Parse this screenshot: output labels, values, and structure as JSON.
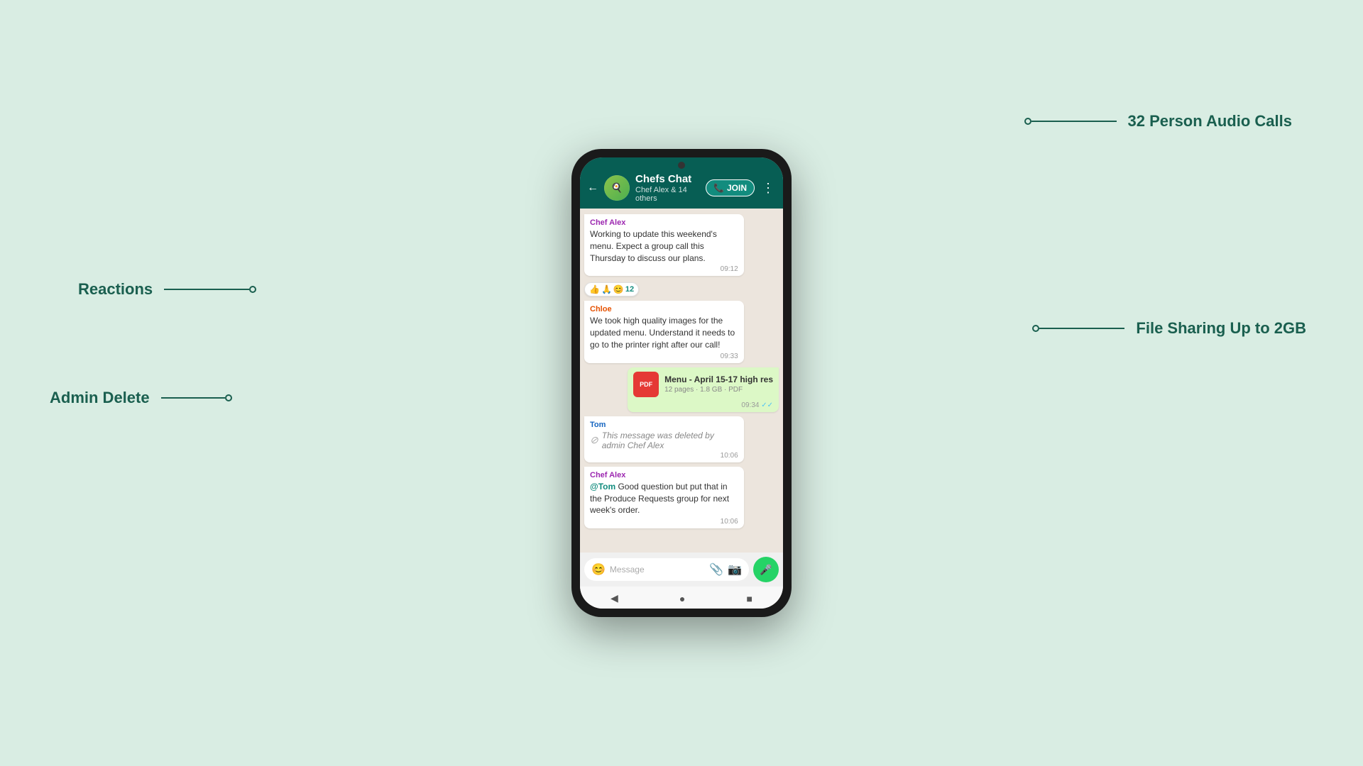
{
  "background": "#d9ede3",
  "phone": {
    "header": {
      "chat_name": "Chefs Chat",
      "chat_subtitle": "Chef Alex & 14 others",
      "join_button_label": "JOIN",
      "more_icon": "⋮"
    },
    "messages": [
      {
        "id": "msg1",
        "type": "incoming",
        "sender": "Chef Alex",
        "sender_color": "purple",
        "text": "Working to update this weekend's menu. Expect a group call this Thursday to discuss our plans.",
        "time": "09:12",
        "reactions": "👍🙏😊 12"
      },
      {
        "id": "msg2",
        "type": "incoming",
        "sender": "Chloe",
        "sender_color": "orange",
        "text": "We took high quality images for the updated menu. Understand it needs to go to the printer right after our call!",
        "time": "09:33"
      },
      {
        "id": "msg3",
        "type": "outgoing",
        "file": {
          "name": "Menu - April 15-17 high res",
          "meta": "12 pages · 1.8 GB · PDF",
          "type": "PDF"
        },
        "time": "09:34",
        "ticks": "✓✓"
      },
      {
        "id": "msg4",
        "type": "incoming",
        "sender": "Tom",
        "sender_color": "blue",
        "deleted": true,
        "deleted_text": "This message was deleted by admin Chef Alex",
        "time": "10:06"
      },
      {
        "id": "msg5",
        "type": "incoming",
        "sender": "Chef Alex",
        "sender_color": "purple",
        "text": "@Tom Good question but put that in the Produce Requests group for next week's order.",
        "time": "10:06",
        "mention": "@Tom"
      }
    ],
    "input_bar": {
      "placeholder": "Message",
      "emoji_icon": "😊",
      "attach_icon": "📎",
      "camera_icon": "📷",
      "mic_icon": "🎤"
    },
    "navbar": {
      "back_icon": "◀",
      "home_icon": "●",
      "square_icon": "■"
    }
  },
  "annotations": {
    "reactions": {
      "label": "Reactions"
    },
    "admin_delete": {
      "label": "Admin Delete"
    },
    "audio_calls": {
      "label": "32 Person Audio Calls"
    },
    "file_sharing": {
      "label": "File Sharing Up to 2GB"
    }
  }
}
